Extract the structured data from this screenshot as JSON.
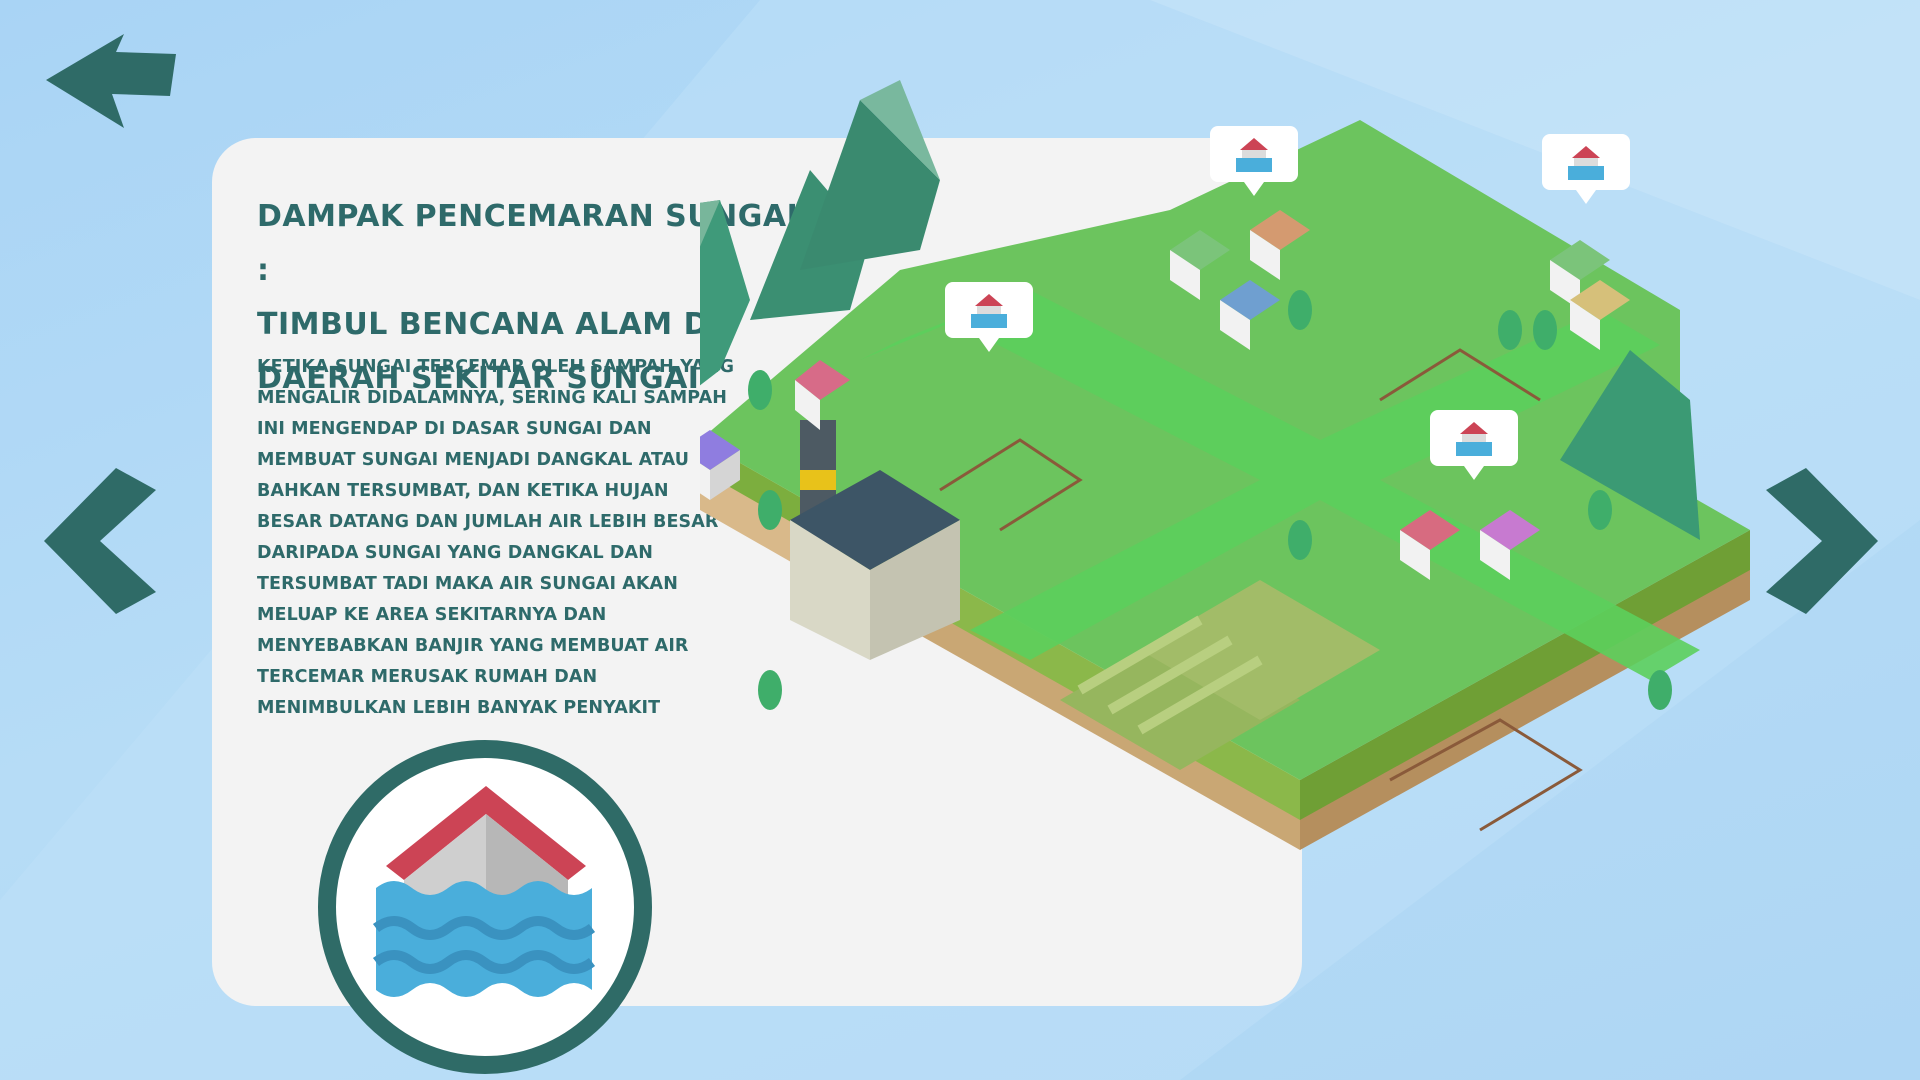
{
  "screen": {
    "title": "Dampak Pencemaran Sungai : Timbul Bencana Alam di Daerah Sekitar Sungai",
    "title_lines": [
      "Dampak Pencemaran Sungai :",
      "Timbul Bencana Alam di",
      "Daerah Sekitar Sungai"
    ],
    "description": "Ketika sungai tercemar oleh sampah yang mengalir didalamnya, sering kali sampah ini mengendap di dasar sungai dan membuat sungai menjadi dangkal atau bahkan tersumbat, dan ketika hujan besar datang dan jumlah air lebih besar daripada sungai yang dangkal dan tersumbat tadi maka air sungai akan meluap ke area sekitarnya dan menyebabkan banjir yang membuat air tercemar merusak rumah dan menimbulkan lebih banyak penyakit"
  },
  "icons": {
    "back": "arrow-back-icon",
    "prev": "chevron-left-icon",
    "next": "chevron-right-icon",
    "flood": "flooded-house-icon",
    "map_pin": "flood-marker-icon"
  },
  "colors": {
    "accent": "#2e6a6a",
    "background": "#aed6f4",
    "card": "#f3f3f3",
    "grass": "#6cc45e",
    "river": "#5ccf5c",
    "roof_red": "#cc4455",
    "water": "#4aaedb"
  },
  "flood_markers": [
    {
      "name": "flood-marker-1"
    },
    {
      "name": "flood-marker-2"
    },
    {
      "name": "flood-marker-3"
    },
    {
      "name": "flood-marker-4"
    }
  ]
}
